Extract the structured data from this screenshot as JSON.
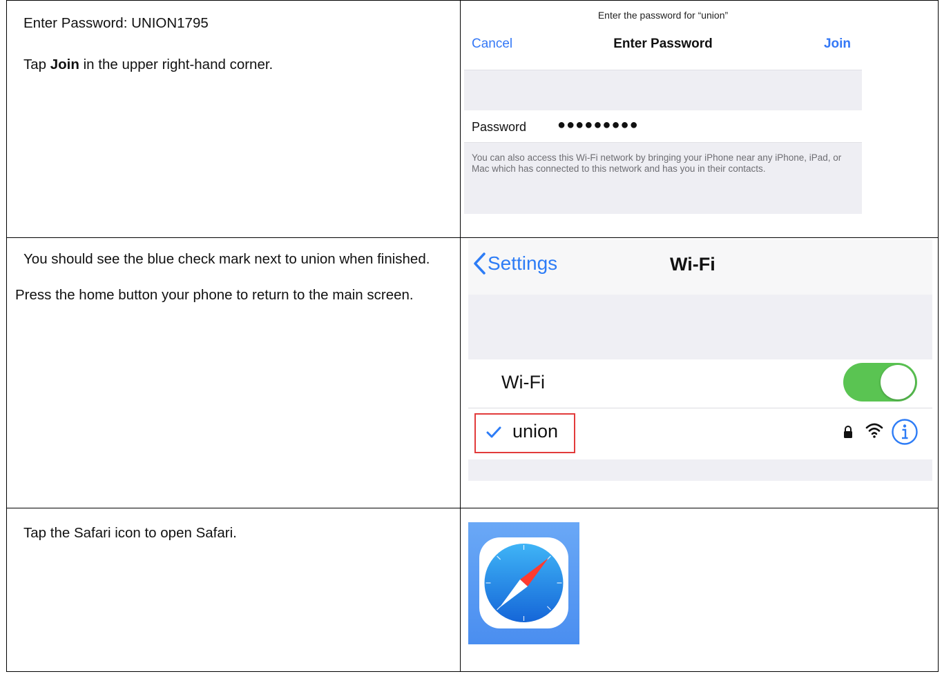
{
  "rows": [
    {
      "instructions": [
        {
          "text": "Enter Password: UNION1795"
        },
        {
          "before": "Tap ",
          "bold": "Join",
          "after": " in the upper right-hand corner."
        }
      ]
    },
    {
      "instructions": [
        {
          "text": "You should see the blue check mark next to union when finished."
        },
        {
          "text": "Press the home button your phone to return to the main screen."
        }
      ]
    },
    {
      "instructions": [
        {
          "text": "Tap the Safari icon to open Safari."
        }
      ]
    }
  ],
  "password_screen": {
    "prompt": "Enter the password for “union”",
    "cancel_label": "Cancel",
    "title": "Enter Password",
    "join_label": "Join",
    "field_label": "Password",
    "masked_value": "●●●●●●●●●",
    "note": "You can also access this Wi-Fi network by bringing your iPhone near any iPhone, iPad, or Mac which has connected to this network and has you in their contacts."
  },
  "wifi_screen": {
    "back_label": "Settings",
    "title": "Wi-Fi",
    "toggle_label": "Wi-Fi",
    "toggle_on": true,
    "network_name": "union",
    "accent_color": "#2d7cf6",
    "toggle_color": "#5ac452",
    "highlight_color": "#e23a3a",
    "icons": [
      "chevron-left-icon",
      "checkmark-icon",
      "lock-icon",
      "wifi-signal-icon",
      "info-icon"
    ]
  },
  "safari": {
    "icon": "safari-compass-icon"
  }
}
